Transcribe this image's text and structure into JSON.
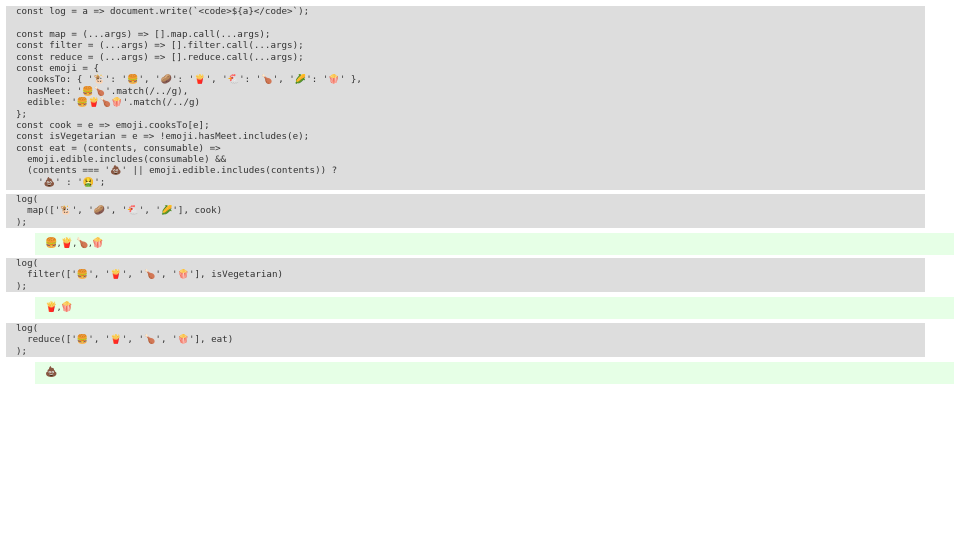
{
  "source_block": {
    "lines": [
      "const log = a => document.write(`<code>${a}</code>`);",
      "",
      "const map = (...args) => [].map.call(...args);",
      "const filter = (...args) => [].filter.call(...args);",
      "const reduce = (...args) => [].reduce.call(...args);",
      "const emoji = {",
      "  cooksTo: { '🐮': '🍔', '🥔': '🍟', '🐔': '🍗', '🌽': '🍿' },",
      "  hasMeet: '🍔🍗'.match(/../g),",
      "  edible: '🍔🍟🍗🍿'.match(/../g)",
      "};",
      "const cook = e => emoji.cooksTo[e];",
      "const isVegetarian = e => !emoji.hasMeet.includes(e);",
      "const eat = (contents, consumable) =>",
      "  emoji.edible.includes(consumable) &&",
      "  (contents === '💩' || emoji.edible.includes(contents)) ?",
      "    '💩' : '🤮';"
    ]
  },
  "examples": [
    {
      "code_lines": [
        "log(",
        "  map(['🐮', '🥔', '🐔', '🌽'], cook)",
        ");"
      ],
      "output": "🍔,🍟,🍗,🍿"
    },
    {
      "code_lines": [
        "log(",
        "  filter(['🍔', '🍟', '🍗', '🍿'], isVegetarian)",
        ");"
      ],
      "output": "🍟,🍿"
    },
    {
      "code_lines": [
        "log(",
        "  reduce(['🍔', '🍟', '🍗', '🍿'], eat)",
        ");"
      ],
      "output": "💩"
    }
  ]
}
